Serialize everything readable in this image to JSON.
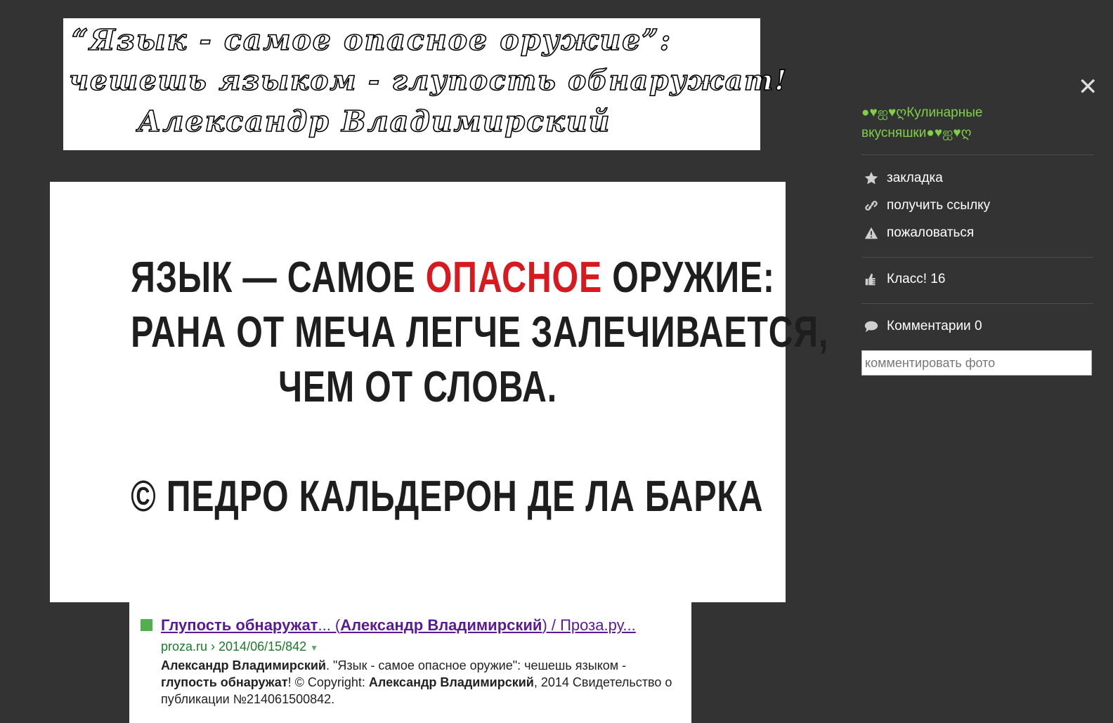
{
  "banner": {
    "line1": "“Язык - самое опасное оружие”:",
    "line2": "чешешь языком - глупость обнаружат!",
    "line3": "Александр Владимирский"
  },
  "photo": {
    "line1_a": "ЯЗЫК — САМОЕ ",
    "line1_red": "ОПАСНОЕ",
    "line1_b": " ОРУЖИЕ:",
    "line2": "РАНА ОТ МЕЧА ЛЕГЧЕ ЗАЛЕЧИВАЕТСЯ,",
    "line3": "ЧЕМ ОТ СЛОВА.",
    "line4": "© ПЕДРО КАЛЬДЕРОН ДЕ ЛА БАРКА",
    "accent_color": "#d71920"
  },
  "snippet": {
    "title_bold1": "Глупость обнаружат",
    "title_mid": "... (",
    "title_bold2": "Александр Владимирский",
    "title_end": ") / Проза.ру...",
    "url": "proza.ru › 2014/06/15/842",
    "desc_b1": "Александр Владимирский",
    "desc_t1": ". \"Язык - самое опасное оружие\": чешешь языком - ",
    "desc_b2": "глупость обнаружат",
    "desc_t2": "! © Copyright: ",
    "desc_b3": "Александр Владимирский",
    "desc_t3": ", 2014 Свидетельство о публикации №214061500842."
  },
  "panel": {
    "group_name": "●♥ஐ♥ღКулинарные вкусняшки●♥ஐ♥ღ",
    "bookmark": "закладка",
    "get_link": "получить ссылку",
    "report": "пожаловаться",
    "likes": "Класс! 16",
    "comments": "Комментарии 0",
    "comment_placeholder": "комментировать фото",
    "accent_color": "#7ed04a"
  }
}
